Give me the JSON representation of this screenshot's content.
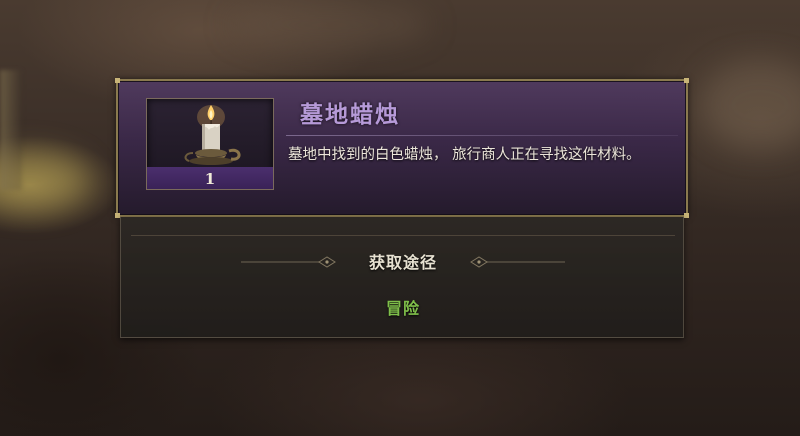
{
  "item": {
    "name": "墓地蜡烛",
    "quantity": "1",
    "description": "墓地中找到的白色蜡烛， 旅行商人正在寻找这件材料。",
    "icon": "candle-icon"
  },
  "acquisition": {
    "title": "获取途径",
    "sources": [
      "冒险"
    ]
  },
  "colors": {
    "item_name": "#b69ad8",
    "source_link": "#7fbf4a",
    "panel_border": "#8a7a4e",
    "header_bg": "#4a345c"
  }
}
